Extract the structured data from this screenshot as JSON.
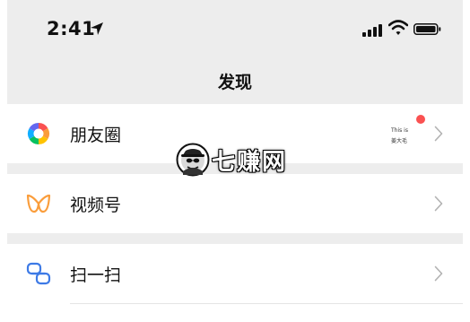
{
  "status_bar": {
    "time": "2:41",
    "icons": [
      "location-arrow-icon",
      "cellular-signal-icon",
      "wifi-icon",
      "battery-icon"
    ]
  },
  "nav": {
    "title": "发现"
  },
  "items": [
    {
      "label": "朋友圈",
      "icon": "moments-icon",
      "thumbnail": {
        "line1": "This is",
        "line2": "姜大毛"
      },
      "has_unread_dot": true
    },
    {
      "label": "视频号",
      "icon": "channels-icon"
    },
    {
      "label": "扫一扫",
      "icon": "scan-icon"
    }
  ],
  "watermark": {
    "text": "七赚网"
  },
  "colors": {
    "background_gray": "#ededed",
    "row_white": "#ffffff",
    "badge_red": "#fa5151",
    "channels_orange": "#fa9d3b",
    "scan_blue": "#3d7ae6",
    "chevron_gray": "#b2b2b2"
  }
}
